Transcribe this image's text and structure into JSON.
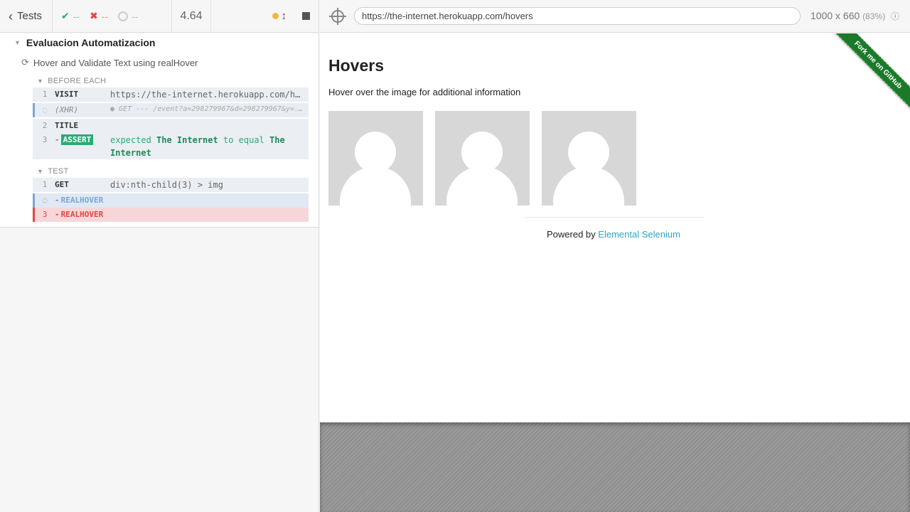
{
  "reporter": {
    "tests_label": "Tests",
    "passed": "--",
    "failed": "--",
    "pending": "--",
    "duration": "4.64",
    "suite_title": "Evaluacion Automatizacion",
    "test_title": "Hover and Validate Text using realHover",
    "before_each_label": "BEFORE EACH",
    "test_label": "TEST",
    "before_each_commands": [
      {
        "num": "1",
        "name": "VISIT",
        "message": "https://the-internet.herokuapp.com/hovers"
      },
      {
        "num": "",
        "name": "(XHR)",
        "message": "● GET --- /event?a=298279967&d=298279967&y=..."
      },
      {
        "num": "2",
        "name": "TITLE",
        "message": ""
      },
      {
        "num": "3",
        "name": "ASSERT",
        "message_prefix": "expected",
        "message_subject": "The Internet",
        "message_mid": "to equal",
        "message_value": "The Internet"
      }
    ],
    "test_commands": [
      {
        "num": "1",
        "name": "GET",
        "message": "div:nth-child(3) > img"
      },
      {
        "num": "",
        "name": "REALHOVER",
        "message": ""
      },
      {
        "num": "3",
        "name": "REALHOVER",
        "message": ""
      }
    ]
  },
  "aut": {
    "url": "https://the-internet.herokuapp.com/hovers",
    "viewport": "1000 x 660",
    "zoom": "(83%)",
    "page": {
      "heading": "Hovers",
      "description": "Hover over the image for additional information",
      "powered_by": "Powered by",
      "powered_link": "Elemental Selenium",
      "ribbon": "Fork me on GitHub"
    }
  },
  "colors": {
    "pass": "#27ae60",
    "fail": "#e0463c",
    "running": "#7aa6d8",
    "assert": "#2bab72",
    "link": "#2ea3c7",
    "ribbon": "#1a7a2a"
  }
}
